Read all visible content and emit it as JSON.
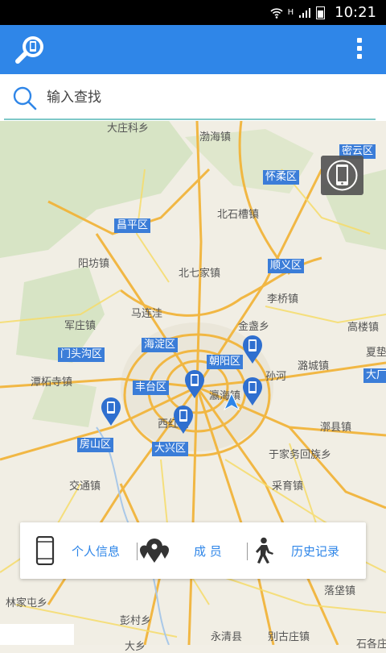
{
  "status_bar": {
    "time": "10:21",
    "network": "H"
  },
  "app_bar": {
    "logo_icon": "phone-search-icon",
    "menu_icon": "overflow-menu-icon"
  },
  "search": {
    "placeholder": "输入查找",
    "value": ""
  },
  "map": {
    "place_labels": [
      "大庄科乡",
      "渤海镇",
      "北石槽镇",
      "阳坊镇",
      "北七家镇",
      "马连洼",
      "李桥镇",
      "金盏乡",
      "高楼镇",
      "军庄镇",
      "潭柘寺镇",
      "孙河",
      "潞城镇",
      "西红门",
      "瀛海镇",
      "于家务回族乡",
      "采育镇",
      "交通镇",
      "林家屯乡",
      "彭村乡",
      "漷县镇",
      "落垡镇",
      "大乡",
      "永清县",
      "别古庄镇",
      "石各庄",
      "夏垫"
    ],
    "district_labels": [
      "怀柔区",
      "昌平区",
      "顺义区",
      "海淀区",
      "朝阳区",
      "门头沟区",
      "丰台区",
      "房山区",
      "大兴区",
      "密云区",
      "大厂"
    ],
    "device_button_icon": "phone-device-icon",
    "pin_icon": "phone-marker-icon",
    "nav_icon": "navigation-arrow-icon"
  },
  "bottom_menu": {
    "items": [
      {
        "icon": "phone-icon",
        "label": "个人信息"
      },
      {
        "icon": "location-pins-icon",
        "label": "成 员"
      },
      {
        "icon": "walking-person-icon",
        "label": "历史记录"
      }
    ]
  },
  "colors": {
    "primary": "#2f86e8",
    "district_bg": "#3b7dd8",
    "search_underline": "#7ec8c8"
  }
}
